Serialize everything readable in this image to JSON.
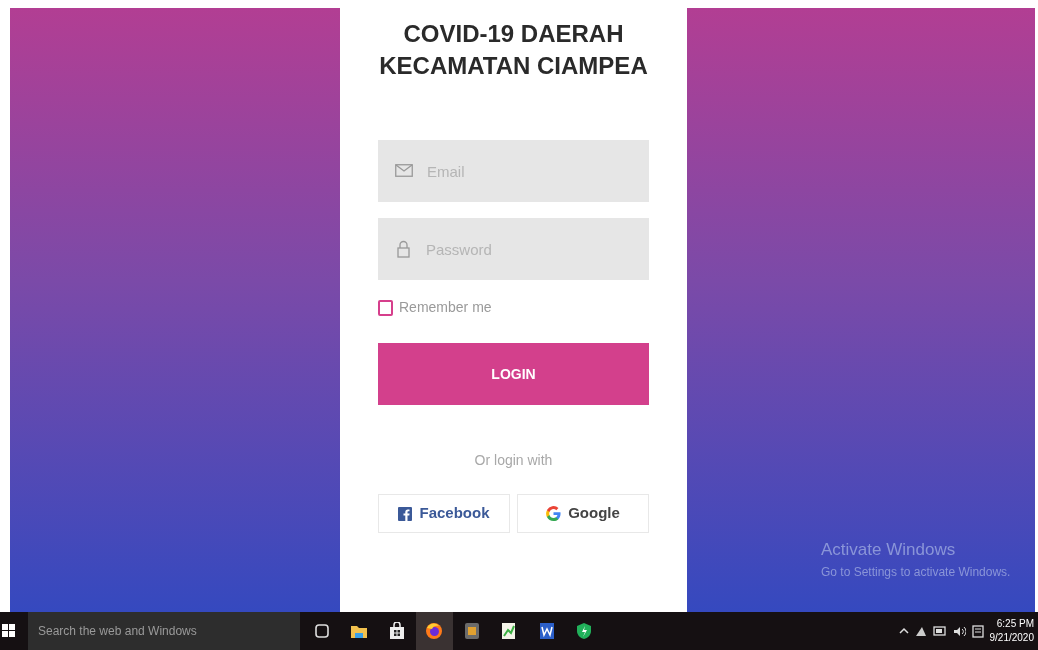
{
  "login_card": {
    "title_lines": [
      "COVID-19 DAERAH",
      "KECAMATAN CIAMPEA"
    ],
    "email": {
      "placeholder": "Email"
    },
    "password": {
      "placeholder": "Password"
    },
    "remember": {
      "label": "Remember me",
      "checked": false
    },
    "login_button": "LOGIN",
    "divider_text": "Or login with",
    "social_buttons": [
      {
        "kind": "facebook",
        "label": "Facebook"
      },
      {
        "kind": "google",
        "label": "Google"
      }
    ]
  },
  "activation_notice": {
    "title": "Activate Windows",
    "subtitle": "Go to Settings to activate Windows."
  },
  "taskbar": {
    "search_placeholder": "Search the web and Windows",
    "apps": [
      {
        "kind": "task-view",
        "selected": false
      },
      {
        "kind": "folder",
        "selected": false
      },
      {
        "kind": "store",
        "selected": false
      },
      {
        "kind": "browser",
        "selected": true
      },
      {
        "kind": "media",
        "selected": false
      },
      {
        "kind": "notepad",
        "selected": false
      },
      {
        "kind": "word",
        "selected": false
      },
      {
        "kind": "shield",
        "selected": false
      }
    ],
    "time": "6:25 PM",
    "date": "9/21/2020"
  }
}
